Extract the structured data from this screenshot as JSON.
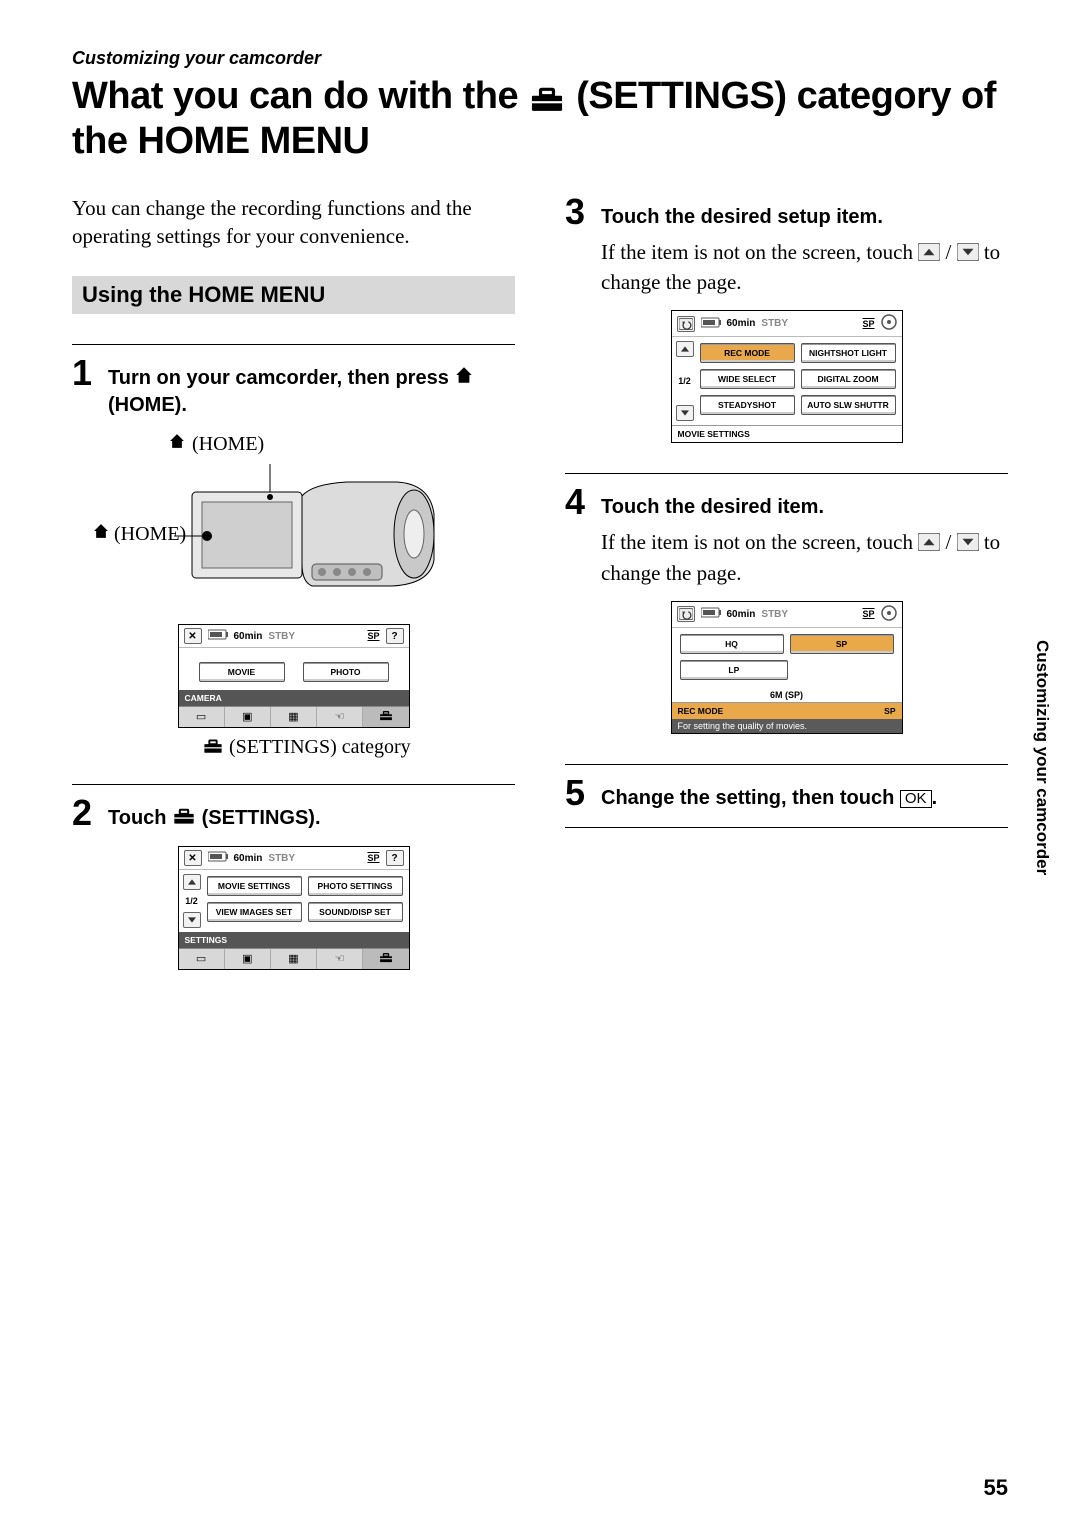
{
  "breadcrumb": "Customizing your camcorder",
  "title_pre": "What you can do with the ",
  "title_post": " (SETTINGS) category of the HOME MENU",
  "intro": "You can change the recording functions and the operating settings for your convenience.",
  "section_heading": "Using the HOME MENU",
  "steps": {
    "s1": {
      "num": "1",
      "title_pre": "Turn on your camcorder, then press ",
      "title_post": " (HOME).",
      "label_home": "(HOME)"
    },
    "s2": {
      "num": "2",
      "title_pre": "Touch ",
      "title_post": " (SETTINGS)."
    },
    "s3": {
      "num": "3",
      "title": "Touch the desired setup item.",
      "body_pre": "If the item is not on the screen, touch ",
      "body_mid": " / ",
      "body_post": " to change the page."
    },
    "s4": {
      "num": "4",
      "title": "Touch the desired item.",
      "body_pre": "If the item is not on the screen, touch ",
      "body_mid": " / ",
      "body_post": " to change the page."
    },
    "s5": {
      "num": "5",
      "title_pre": "Change the setting, then touch ",
      "title_post": "."
    }
  },
  "screens": {
    "common": {
      "battery": "60min",
      "status": "STBY",
      "mode": "SP",
      "page": "1/2",
      "close": "✕",
      "help": "?"
    },
    "camera": {
      "buttons": [
        "MOVIE",
        "PHOTO"
      ],
      "footer": "CAMERA",
      "caption": "(SETTINGS) category"
    },
    "settings": {
      "buttons": [
        "MOVIE SETTINGS",
        "PHOTO SETTINGS",
        "VIEW IMAGES SET",
        "SOUND/DISP SET"
      ],
      "footer": "SETTINGS"
    },
    "movie_settings": {
      "buttons": [
        "REC MODE",
        "NIGHTSHOT LIGHT",
        "WIDE SELECT",
        "DIGITAL ZOOM",
        "STEADYSHOT",
        "AUTO SLW SHUTTR"
      ],
      "footer": "MOVIE SETTINGS"
    },
    "rec_mode": {
      "buttons": [
        "HQ",
        "SP",
        "LP"
      ],
      "center": "6M (SP)",
      "footer_left": "REC MODE",
      "footer_right": "SP",
      "note": "For setting the quality of movies."
    }
  },
  "ok_label": "OK",
  "side_text": "Customizing your camcorder",
  "page_number": "55"
}
